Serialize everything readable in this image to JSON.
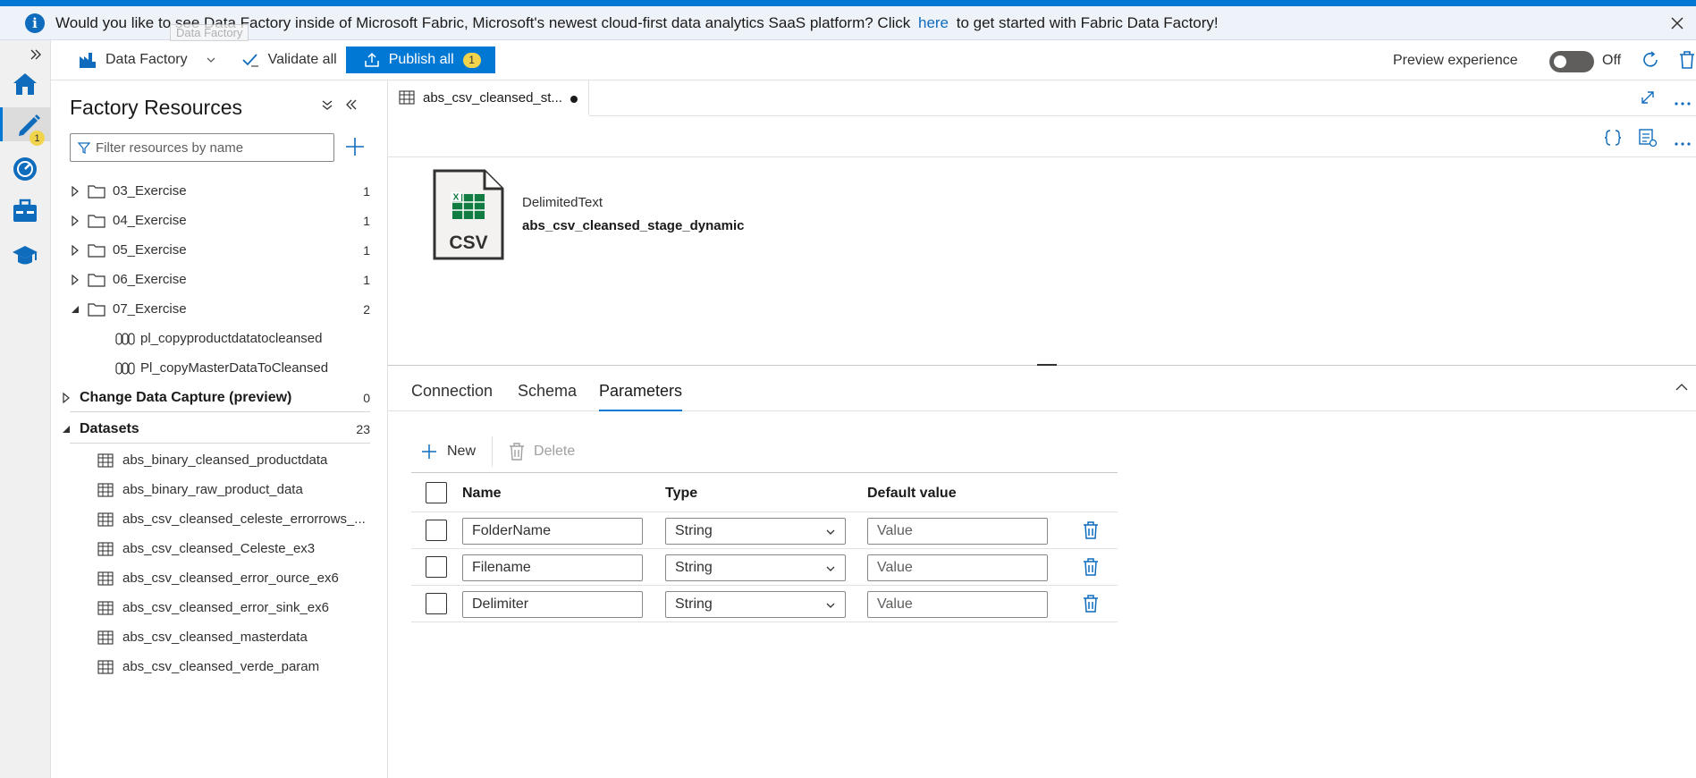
{
  "banner": {
    "text_before": "Would you like to see Data Factory inside of Microsoft Fabric, Microsoft's newest cloud-first data analytics SaaS platform? Click",
    "link": "here",
    "text_after": "to get started with Fabric Data Factory!",
    "tooltip": "Data Factory"
  },
  "toolbar": {
    "factory_name": "Data Factory",
    "validate_all": "Validate all",
    "publish_all": "Publish all",
    "publish_count": "1",
    "preview_label": "Preview experience",
    "toggle_state": "Off"
  },
  "rail": {
    "author_badge": "1"
  },
  "resources": {
    "title": "Factory Resources",
    "filter_placeholder": "Filter resources by name",
    "folders": [
      {
        "label": "03_Exercise",
        "count": "1"
      },
      {
        "label": "04_Exercise",
        "count": "1"
      },
      {
        "label": "05_Exercise",
        "count": "1"
      },
      {
        "label": "06_Exercise",
        "count": "1"
      },
      {
        "label": "07_Exercise",
        "count": "2"
      }
    ],
    "pipelines": [
      {
        "label": "pl_copyproductdatatocleansed"
      },
      {
        "label": "Pl_copyMasterDataToCleansed"
      }
    ],
    "cdc": {
      "label": "Change Data Capture (preview)",
      "count": "0"
    },
    "datasets": {
      "label": "Datasets",
      "count": "23"
    },
    "dataset_items": [
      "abs_binary_cleansed_productdata",
      "abs_binary_raw_product_data",
      "abs_csv_cleansed_celeste_errorrows_...",
      "abs_csv_cleansed_Celeste_ex3",
      "abs_csv_cleansed_error_ource_ex6",
      "abs_csv_cleansed_error_sink_ex6",
      "abs_csv_cleansed_masterdata",
      "abs_csv_cleansed_verde_param"
    ]
  },
  "editor": {
    "tab_title": "abs_csv_cleansed_st...",
    "dataset_type": "DelimitedText",
    "dataset_name": "abs_csv_cleansed_stage_dynamic",
    "icon_text": "CSV"
  },
  "props": {
    "tabs": [
      "Connection",
      "Schema",
      "Parameters"
    ],
    "new_label": "New",
    "delete_label": "Delete",
    "columns": {
      "name": "Name",
      "type": "Type",
      "default": "Default value"
    },
    "rows": [
      {
        "name": "FolderName",
        "type": "String",
        "default_placeholder": "Value"
      },
      {
        "name": "Filename",
        "type": "String",
        "default_placeholder": "Value"
      },
      {
        "name": "Delimiter",
        "type": "String",
        "default_placeholder": "Value"
      }
    ]
  },
  "colors": {
    "accent": "#0078d4",
    "badge": "#f2d44c",
    "excel_green": "#107c41"
  }
}
